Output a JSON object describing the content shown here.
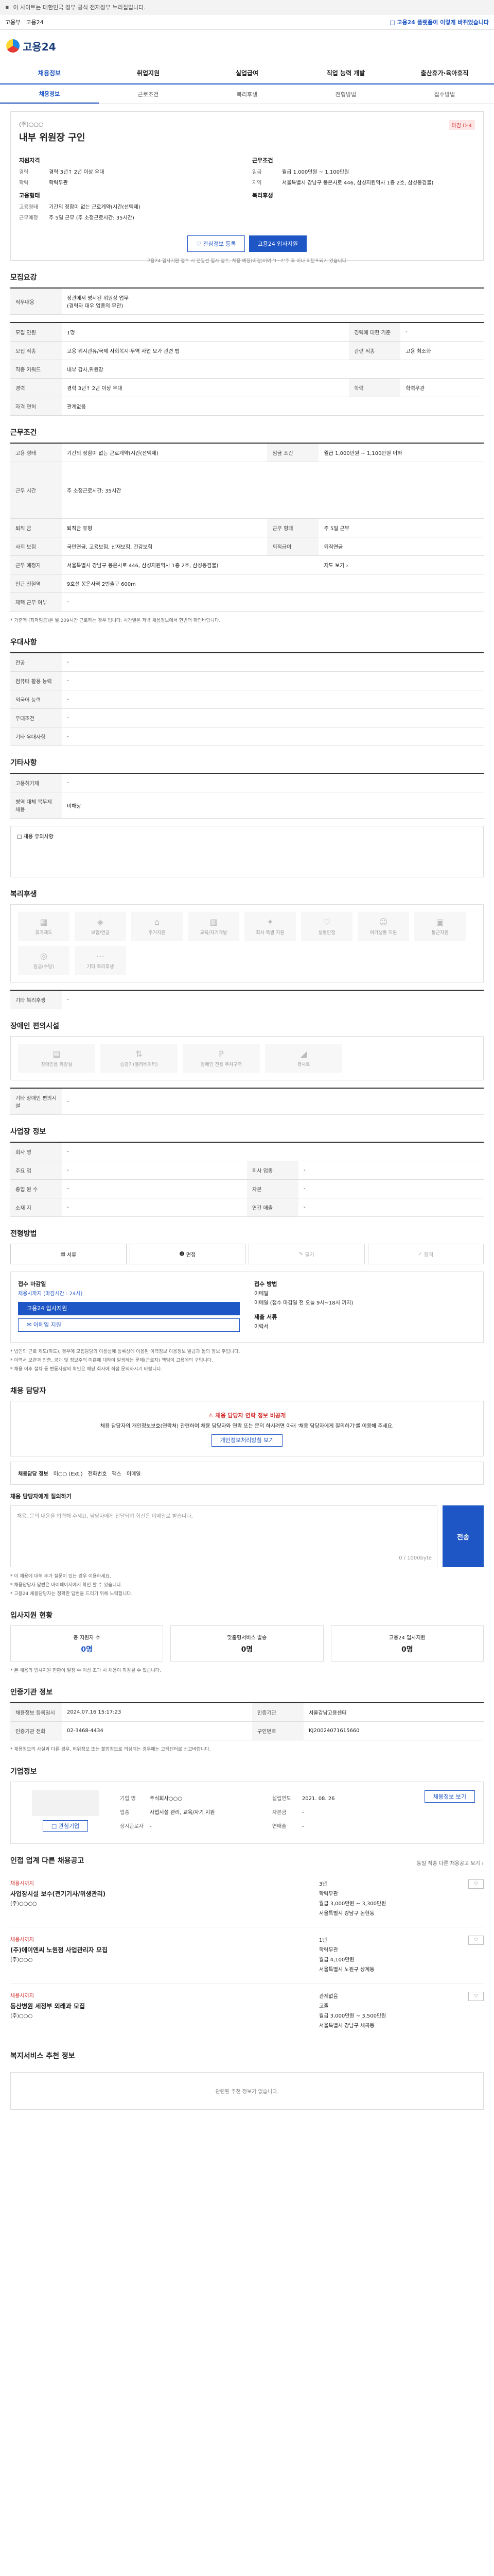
{
  "topbar": {
    "notice": "이 사이트는 대한민국 정부 공식 전자정부 누리집입니다."
  },
  "service_bar": {
    "link1": "고용부",
    "link2": "고용24",
    "gov": "□ 고용24 플랫폼이 이렇게 바뀌었습니다"
  },
  "logo": {
    "name": "고용24"
  },
  "gnb": [
    "채용정보",
    "취업지원",
    "실업급여",
    "직업 능력 개발",
    "출산휴가·육아휴직"
  ],
  "subnav": [
    "채용정보",
    "근로조건",
    "복리후생",
    "전형방법",
    "접수방법"
  ],
  "job": {
    "company": "(주)○○○",
    "title": "내부 위원장 구인",
    "badge": "마감 D-4",
    "left": {
      "heading": "지원자격",
      "items": [
        {
          "k": "경력",
          "v": "경력 3년↑ 2년 이상 우대"
        },
        {
          "k": "학력",
          "v": "학력무관"
        }
      ],
      "heading2": "고용형태",
      "items2": [
        {
          "k": "고용형태",
          "v": "기간의 정함이 없는 근로계약(시간(선택제)"
        },
        {
          "k": "근무예정",
          "v": "주 5일 근무 (주 소정근로시간: 35시간)"
        }
      ]
    },
    "right": {
      "heading": "근무조건",
      "items": [
        {
          "k": "임금",
          "v": "월급 1,000만원 ~ 1,100만원"
        },
        {
          "k": "지역",
          "v": "서울특별시 강남구 봉은사로 446, 삼성지원역사 1층 2호, 삼성동겸불)"
        }
      ],
      "heading2": "복리후생",
      "items2": []
    },
    "btn_save": "관심정보 등록",
    "btn_apply": "고용24 입사지원",
    "notice": "고용24 입사지원 접수 시 전일선 입사 접수, 채용 예정(미정)이며 '1~2'주 후 이나 미분포되기 있습니다."
  },
  "recruit": {
    "heading": "모집요강",
    "sub_head": "직무내용",
    "duties": [
      "정관에서 명시된 위원장 업무",
      "(경력자 대우 업종의 무관)"
    ],
    "rows": [
      {
        "k": "모집 인원",
        "v": "1명",
        "k2": "경력에 대한 기준",
        "v2": "-"
      },
      {
        "k": "모집 직종",
        "v": "고용 위시관유/국제 사회복지·무역 사업 보가 관련 법",
        "k2": "관련 직종",
        "v2": "고용 최소화"
      },
      {
        "k": "직종 키워드",
        "v": "내부 감사,위원장",
        "k2": "",
        "v2": ""
      },
      {
        "k": "경력",
        "v": "경력 3년↑ 2년 이상 우대",
        "k2": "학력",
        "v2": "학력무관"
      },
      {
        "k": "자격 면허",
        "v": "관계없음",
        "k2": "",
        "v2": ""
      }
    ]
  },
  "conditions": {
    "heading": "근무조건",
    "rows": [
      {
        "k": "고용 형태",
        "v": "기간의 정함이 없는 근로계약(시간(선택제)",
        "k2": "임금 조건",
        "v2": "월급 1,000만원 ~ 1,100만원 이하"
      },
      {
        "k": "근무 시간",
        "v": "주 소정근로시간: 35시간",
        "k2": "",
        "v2": ""
      },
      {
        "k": "퇴직 금",
        "v": "퇴직금 유형",
        "k2": "근무 형태",
        "v2": "주 5일 근무"
      },
      {
        "k": "사회 보험",
        "v": "국민연금, 고용보험, 산재보험, 건강보험",
        "k2": "퇴직급여",
        "v2": "퇴직연금"
      },
      {
        "k": "근무 예정지",
        "v": "서울특별시 강남구 봉은사로 446, 삼성지원역사 1층 2호, 삼성동겸불)",
        "k2": "",
        "v2": "지도 보기 ›"
      },
      {
        "k": "인근 전철역",
        "v": "9호선 봉은사역 2번출구 600m",
        "k2": "",
        "v2": ""
      },
      {
        "k": "재택 근무 여부",
        "v": "-",
        "k2": "",
        "v2": ""
      }
    ],
    "footnote": "* 기준액 (최저임금)은 월 209시간 근로하는 경우 입니다. 시간별은 저녁 채용정보에서 한번더 확인바랍니다."
  },
  "preference": {
    "heading": "우대사항",
    "rows": [
      {
        "k": "전공",
        "v": "-"
      },
      {
        "k": "컴퓨터 활용 능력",
        "v": "-"
      },
      {
        "k": "외국어 능력",
        "v": "-"
      },
      {
        "k": "우대조건",
        "v": "-"
      },
      {
        "k": "기타 우대사항",
        "v": "-"
      }
    ]
  },
  "other": {
    "heading": "기타사항",
    "rows": [
      {
        "k": "고용허가제",
        "v": "-"
      },
      {
        "k": "병역 대체 복무제 채용",
        "v": "비해당"
      }
    ],
    "desc": "□ 채용 유의사항"
  },
  "welfare": {
    "heading": "복리후생",
    "items": [
      "휴가제도",
      "보험/연금",
      "주거지원",
      "교육/자기개발",
      "회사 특별 지원",
      "생활안정",
      "여가생활 지원",
      "통근지원",
      "임금(수당)",
      "기타 복리후생"
    ],
    "etc_label": "기타 복리후생",
    "etc_value": "-"
  },
  "disabled": {
    "heading": "장애인 편의시설",
    "items": [
      "장애인용 화장실",
      "승강기(엘리베이터)",
      "장애인 전용 주차구역",
      "경사로"
    ],
    "etc_label": "기타 장애인 편의시설",
    "etc_value": "-"
  },
  "workplace": {
    "heading": "사업장 정보",
    "rows": [
      {
        "k": "회사 명",
        "v": "-",
        "k2": "",
        "v2": ""
      },
      {
        "k": "주요 업",
        "v": "-",
        "k2": "회사 업종",
        "v2": "-"
      },
      {
        "k": "종업 원 수",
        "v": "-",
        "k2": "자본",
        "v2": "-"
      },
      {
        "k": "소재 지",
        "v": "-",
        "k2": "연간 매출",
        "v2": "-"
      }
    ]
  },
  "selection": {
    "heading": "전형방법",
    "steps": [
      "서류",
      "면접",
      "필기",
      "합격"
    ],
    "apply": {
      "h1": "접수 마감일",
      "deadline": "채용시까지 (마감시간 : 24시)",
      "btn1": "고용24 입사지원",
      "btn2": "이메일 지원",
      "h2": "접수 방법",
      "method1": "이메일",
      "method2": "이메일 (접수 마감일 전 오늘 9시~18시 까지)",
      "h3": "제출 서류",
      "docs": "이력서"
    },
    "notes": [
      "* 법인의 근로 제도(하도), 경우에 모집담당의 이용상에 등록상에 이용된 이력정보 이용정보 발급과 동의 정보 주입니다.",
      "* 이력서 보관과 인증, 공개 및 정보주의 미흡에 대하여 발생하는 문제(근로자) 책임이 고용에의 구입니다.",
      "* 채용 이후 절차 등 변동사항의 확인은 해당 회사에 직접 문의하시기 바랍니다."
    ]
  },
  "manager": {
    "heading": "채용 담당자",
    "alert_title": "채용 담당자 연락 정보 비공개",
    "alert_body": "채용 담당자의 개인정보보호(연락처) 관련하여 채용 담당자와 연락 또는 문의 하시려면 아래 '채용 담당자에게 질의하기'를 이용해 주세요.",
    "alert_btn": "개인정보처리방침 보기",
    "name_label": "채용담당 정보",
    "name": "이○○ (Ext.)",
    "phone_label": "전화번호",
    "fax_label": "팩스",
    "email_label": "이메일",
    "q_heading": "채용 담당자에게 질의하기",
    "q_placeholder": "채용, 문의 내용을 입력해 주세요. 담당자에게 전달되며 회신은 이메일로 받습니다.",
    "q_count": "0 / 1000byte",
    "send": "전송",
    "notes": [
      "* 이 채용에 대해 추가 질문이 있는 경우 이용하세요.",
      "* 채용담당자 답변은 마이페이지에서 확인 할 수 있습니다.",
      "* 고용24 채용담당자는 정확한 답변을 드리기 위해 노력합니다."
    ]
  },
  "status": {
    "heading": "입사지원 현황",
    "items": [
      {
        "label": "총 지원자 수",
        "value": "0명"
      },
      {
        "label": "맞춤형서비스 발송",
        "value": "0명"
      },
      {
        "label": "고용24 입사지원",
        "value": "0명"
      }
    ],
    "note": "* 본 채용의 입사지원 현황이 일정 수 이상 초과 시 채용이 마감될 수 있습니다."
  },
  "reginfo": {
    "heading": "인증기관 정보",
    "rows": [
      {
        "k": "채용정보 등록일시",
        "v": "2024.07.16 15:17:23",
        "k2": "인증기관",
        "v2": "서울강남고용센터"
      },
      {
        "k": "인증기관 전화",
        "v": "02-3468-4434",
        "k2": "구인번호",
        "v2": "KJ20024071615660"
      }
    ],
    "notes": "* 채용정보의 사실과 다른 경우, 허위정보 또는 불법정보로 의심되는 경우에는 고객센터로 신고바랍니다."
  },
  "company": {
    "heading": "기업정보",
    "left_btn": "□ 관심기업",
    "right_btn": "채용정보 보기",
    "rows": [
      {
        "k": "기업 명",
        "v": "주식회사○○○"
      },
      {
        "k": "업종",
        "v": "사업시설 관리, 교육/자기 지원"
      },
      {
        "k": "상시근로자",
        "v": "-"
      }
    ],
    "rows2": [
      {
        "k": "설립연도",
        "v": "2021. 08. 26"
      },
      {
        "k": "자본금",
        "v": "-"
      },
      {
        "k": "연매출",
        "v": "-"
      }
    ]
  },
  "similar": {
    "heading": "인접 업계 다른 채용공고",
    "more": "동일 직종 다른 채용공고 보기 ›",
    "items": [
      {
        "label": "채용시까지",
        "title": "사업장시설 보수(전기기사/위생관리)",
        "comp": "(주)○○○○",
        "exp": "3년",
        "edu": "학력무관",
        "pay": "월급 3,000만원 ~ 3,300만원",
        "loc": "서울특별시 강남구 논현동"
      },
      {
        "label": "채용시까지",
        "title": "(주)에이엔씨 노원점 사업관리자 모집",
        "comp": "(주)○○○",
        "exp": "1년",
        "edu": "학력무관",
        "pay": "월급 4,100만원",
        "loc": "서울특별시 노원구 상계동"
      },
      {
        "label": "채용시까지",
        "title": "동산병원 세정부 외래과 모집",
        "comp": "(주)○○○",
        "exp": "관계없음",
        "edu": "고졸",
        "pay": "월급 3,000만원 ~ 3,500만원",
        "loc": "서울특별시 강남구 세곡동"
      }
    ]
  },
  "recommend": {
    "heading": "복지서비스 추천 정보",
    "empty": "관련된 추천 정보가 없습니다."
  },
  "colors": {
    "primary": "#1f56c5",
    "alert": "#d32f2f"
  }
}
